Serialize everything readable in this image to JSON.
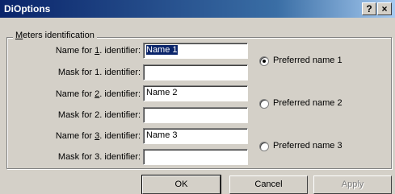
{
  "window": {
    "title": "DiOptions",
    "help_label": "?",
    "close_label": "×"
  },
  "group": {
    "label": "Meters identification"
  },
  "rows": [
    {
      "label_pre": "Name for ",
      "label_key": "1",
      "label_post": ". identifier:",
      "value": "Name 1"
    },
    {
      "label_pre": "Mask for 1. identifier:",
      "label_key": "",
      "label_post": "",
      "value": ""
    },
    {
      "label_pre": "Name for ",
      "label_key": "2",
      "label_post": ". identifier:",
      "value": "Name 2"
    },
    {
      "label_pre": "Mask for 2. identifier:",
      "label_key": "",
      "label_post": "",
      "value": ""
    },
    {
      "label_pre": "Name for ",
      "label_key": "3",
      "label_post": ". identifier:",
      "value": "Name 3"
    },
    {
      "label_pre": "Mask for 3. identifier:",
      "label_key": "",
      "label_post": "",
      "value": ""
    }
  ],
  "radios": [
    {
      "label": "Preferred name 1",
      "checked": true
    },
    {
      "label": "Preferred name 2",
      "checked": false
    },
    {
      "label": "Preferred name 3",
      "checked": false
    }
  ],
  "buttons": {
    "ok": "OK",
    "cancel": "Cancel",
    "apply": "Apply"
  },
  "colors": {
    "title_bar": "#0a246a",
    "face": "#d4d0c8",
    "selection": "#0a246a"
  }
}
